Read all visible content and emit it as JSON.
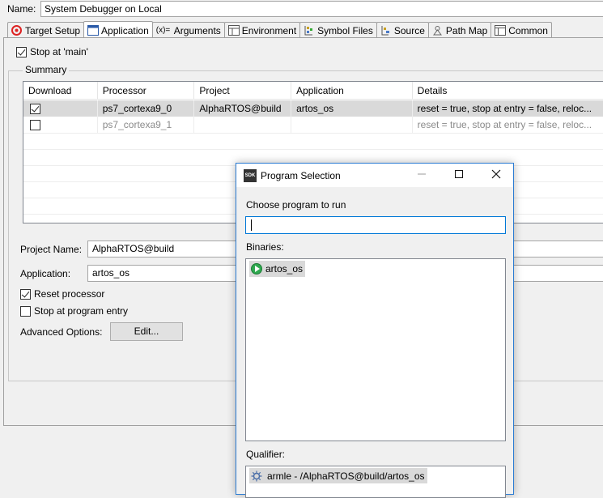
{
  "config": {
    "name_label": "Name:",
    "name_value": "System Debugger on Local"
  },
  "tabs": [
    {
      "label": "Target Setup",
      "icon": "target-icon"
    },
    {
      "label": "Application",
      "icon": "application-icon"
    },
    {
      "label": "Arguments",
      "icon": "arguments-icon"
    },
    {
      "label": "Environment",
      "icon": "environment-icon"
    },
    {
      "label": "Symbol Files",
      "icon": "symbol-files-icon"
    },
    {
      "label": "Source",
      "icon": "source-icon"
    },
    {
      "label": "Path Map",
      "icon": "path-map-icon"
    },
    {
      "label": "Common",
      "icon": "common-icon"
    }
  ],
  "app_tab": {
    "stop_at_main": "Stop at 'main'",
    "summary_title": "Summary",
    "columns": [
      "Download",
      "Processor",
      "Project",
      "Application",
      "Details"
    ],
    "rows": [
      {
        "download": true,
        "processor": "ps7_cortexa9_0",
        "project": "AlphaRTOS@build",
        "application": "artos_os",
        "details": "reset = true, stop at entry = false, reloc..."
      },
      {
        "download": false,
        "processor": "ps7_cortexa9_1",
        "project": "",
        "application": "",
        "details": "reset = true, stop at entry = false, reloc..."
      }
    ],
    "project_name_label": "Project Name:",
    "project_name_value": "AlphaRTOS@build",
    "application_label": "Application:",
    "application_value": "artos_os",
    "reset_processor": "Reset processor",
    "stop_at_entry": "Stop at program entry",
    "advanced_label": "Advanced Options:",
    "edit_button": "Edit..."
  },
  "dialog": {
    "title": "Program Selection",
    "icon_text": "SDK",
    "choose_label": "Choose program to run",
    "search_value": "",
    "binaries_label": "Binaries:",
    "binaries": [
      "artos_os"
    ],
    "qualifier_label": "Qualifier:",
    "qualifiers": [
      "armle - /AlphaRTOS@build/artos_os"
    ]
  }
}
